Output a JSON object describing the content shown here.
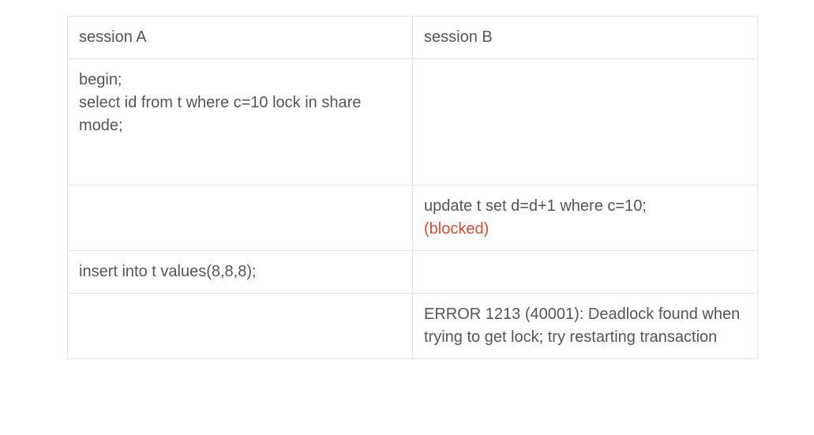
{
  "columns": {
    "a": "session A",
    "b": "session B"
  },
  "rows": [
    {
      "a_lines": [
        "begin;",
        "select id from t where c=10 lock in share mode;"
      ],
      "b_lines": null,
      "tall": true
    },
    {
      "a_lines": null,
      "b_lines": [
        {
          "text": "update t set d=d+1 where c=10;"
        },
        {
          "text": "(blocked)",
          "blocked": true
        }
      ]
    },
    {
      "a_lines": [
        "insert into t values(8,8,8);"
      ],
      "b_lines": null
    },
    {
      "a_lines": null,
      "b_lines": [
        {
          "text": "ERROR 1213 (40001): Deadlock found when trying to get lock; try restarting transaction"
        }
      ]
    }
  ]
}
